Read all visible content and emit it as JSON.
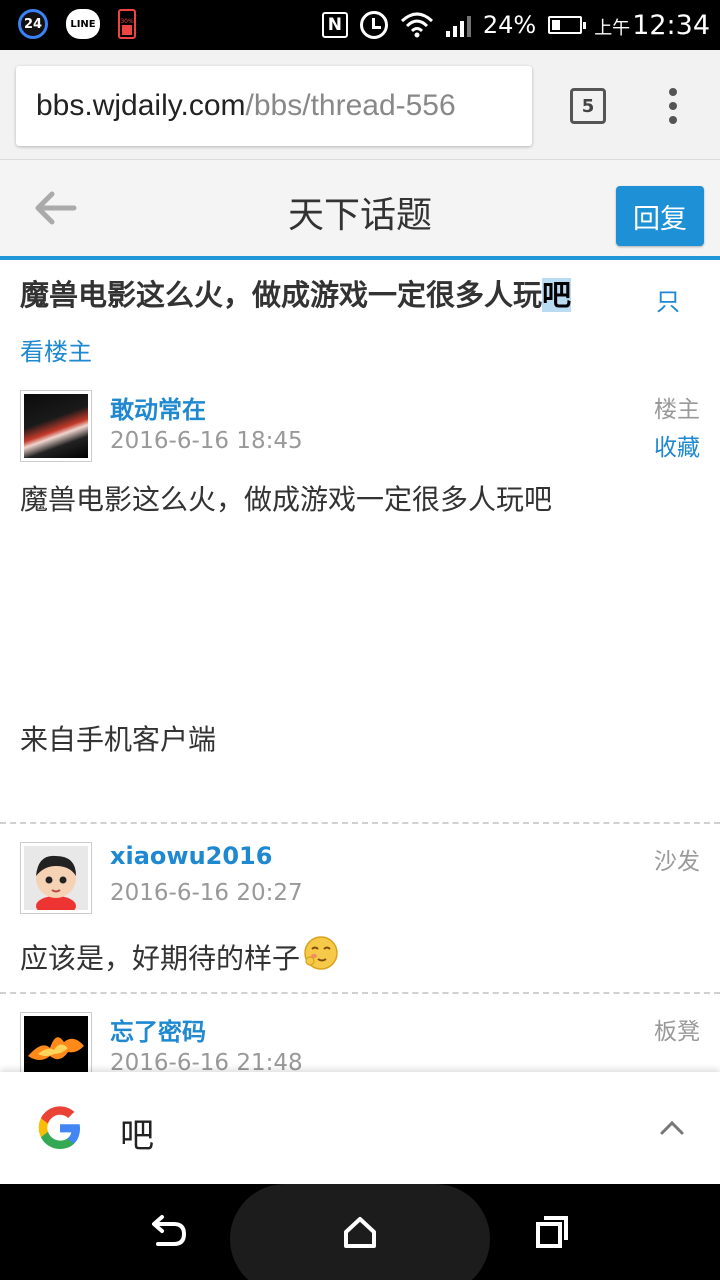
{
  "status_bar": {
    "notif_badge": "24",
    "line_label": "LINE",
    "battery_saver_label": "30%",
    "nfc_label": "N",
    "battery_percent": "24%",
    "time_prefix": "上午",
    "time": "12:34"
  },
  "browser": {
    "url_host": "bbs.wjdaily.com",
    "url_path": "/bbs/thread-556",
    "tab_count": "5"
  },
  "header": {
    "title": "天下话题",
    "reply_label": "回复"
  },
  "thread": {
    "title_main": "魔兽电影这么火，做成游戏一定很多人玩",
    "title_selected": "吧",
    "only_op_part1": "只",
    "only_op_part2": "看楼主"
  },
  "posts": [
    {
      "author": "敢动常在",
      "time": "2016-6-16 18:45",
      "floor": "楼主",
      "favorite_label": "收藏",
      "content": "魔兽电影这么火，做成游戏一定很多人玩吧",
      "footer": "来自手机客户端"
    },
    {
      "author": "xiaowu2016",
      "time": "2016-6-16 20:27",
      "floor": "沙发",
      "content": "应该是，好期待的样子"
    },
    {
      "author": "忘了密码",
      "time": "2016-6-16 21:48",
      "floor": "板凳"
    }
  ],
  "google_bar": {
    "query": "吧"
  },
  "colors": {
    "accent": "#1e88d0",
    "reply_button": "#1e90d6",
    "header_rule": "#2196d9",
    "selection": "#b9dcf2"
  }
}
